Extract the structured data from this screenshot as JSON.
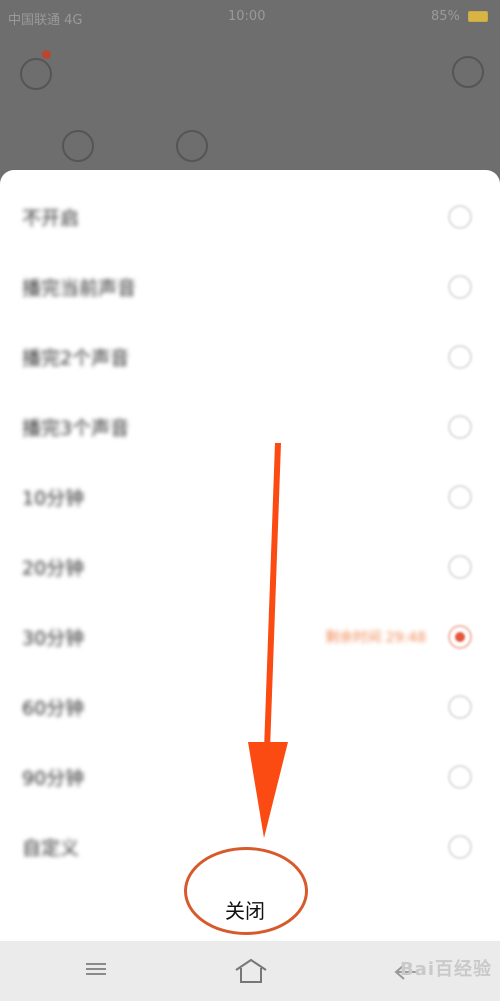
{
  "statusbar": {
    "carrier": "中国联通 4G",
    "time": "10:00",
    "battery": "85%"
  },
  "options": [
    {
      "label": "不开启",
      "selected": false,
      "note": ""
    },
    {
      "label": "播完当前声音",
      "selected": false,
      "note": ""
    },
    {
      "label": "播完2个声音",
      "selected": false,
      "note": ""
    },
    {
      "label": "播完3个声音",
      "selected": false,
      "note": ""
    },
    {
      "label": "10分钟",
      "selected": false,
      "note": ""
    },
    {
      "label": "20分钟",
      "selected": false,
      "note": ""
    },
    {
      "label": "30分钟",
      "selected": true,
      "note": "剩余时间 29:48"
    },
    {
      "label": "60分钟",
      "selected": false,
      "note": ""
    },
    {
      "label": "90分钟",
      "selected": false,
      "note": ""
    },
    {
      "label": "自定义",
      "selected": false,
      "note": ""
    }
  ],
  "close": {
    "label": "关闭"
  },
  "watermark": "Bai百经验",
  "colors": {
    "annotation_arrow": "#fb4a12",
    "selected_radio": "#e8553a",
    "close_ring": "#d65a2c"
  }
}
